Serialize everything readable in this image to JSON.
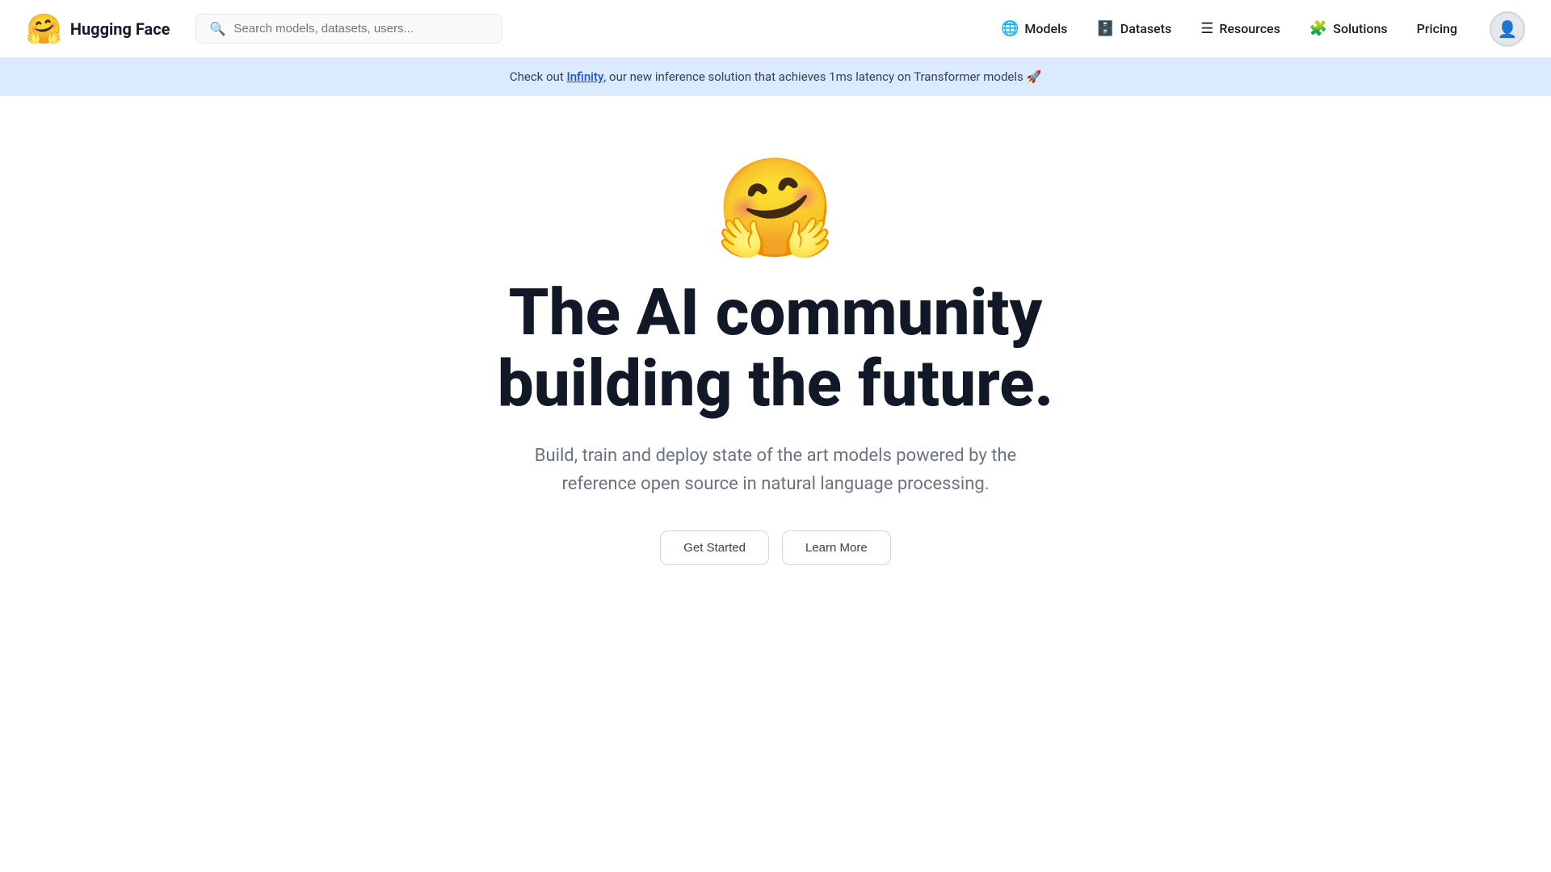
{
  "brand": {
    "logo_emoji": "🤗",
    "logo_text": "Hugging Face"
  },
  "search": {
    "placeholder": "Search models, datasets, users..."
  },
  "nav": {
    "links": [
      {
        "id": "models",
        "icon": "🌐",
        "label": "Models"
      },
      {
        "id": "datasets",
        "icon": "🗄️",
        "label": "Datasets"
      },
      {
        "id": "resources",
        "icon": "☰",
        "label": "Resources"
      },
      {
        "id": "solutions",
        "icon": "🧩",
        "label": "Solutions"
      }
    ],
    "pricing_label": "Pricing"
  },
  "announcement": {
    "text_before": "Check out ",
    "link_text": "Infinity",
    "text_after": ", our new inference solution that achieves 1ms latency on Transformer models 🚀"
  },
  "hero": {
    "emoji": "🤗",
    "title_line1": "The AI community",
    "title_line2": "building the future.",
    "subtitle": "Build, train and deploy state of the art models powered by the reference open source in natural language processing.",
    "btn1_label": "Get Started",
    "btn2_label": "Learn More"
  }
}
